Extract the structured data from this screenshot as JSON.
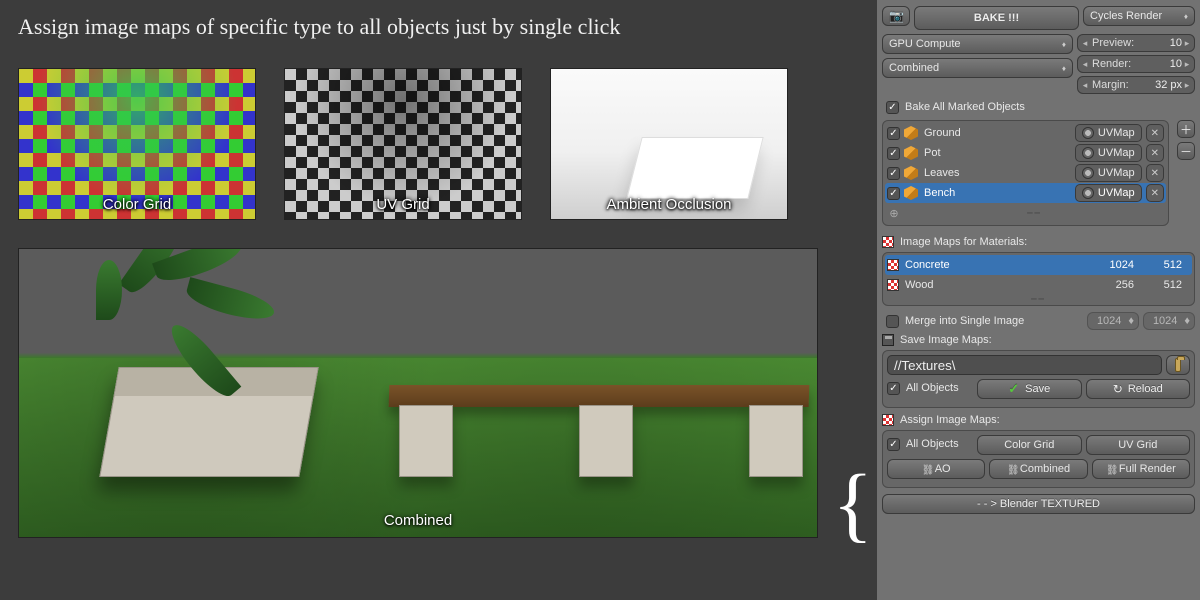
{
  "headline": "Assign image maps of specific type to all objects just by single click",
  "thumbs": [
    {
      "label": "Color Grid"
    },
    {
      "label": "UV Grid"
    },
    {
      "label": "Ambient Occlusion"
    }
  ],
  "big_label": "Combined",
  "panel": {
    "bake_button": "BAKE !!!",
    "render_engine": "Cycles Render",
    "device": "GPU Compute",
    "bake_pass": "Combined",
    "preview": {
      "label": "Preview:",
      "value": "10"
    },
    "render": {
      "label": "Render:",
      "value": "10"
    },
    "margin": {
      "label": "Margin:",
      "value": "32 px"
    },
    "bake_all_label": "Bake All Marked Objects",
    "objects": [
      {
        "name": "Ground",
        "uv": "UVMap",
        "selected": false
      },
      {
        "name": "Pot",
        "uv": "UVMap",
        "selected": false
      },
      {
        "name": "Leaves",
        "uv": "UVMap",
        "selected": false
      },
      {
        "name": "Bench",
        "uv": "UVMap",
        "selected": true
      }
    ],
    "materials_header": "Image Maps for Materials:",
    "materials": [
      {
        "name": "Concrete",
        "w": "1024",
        "h": "512",
        "selected": true
      },
      {
        "name": "Wood",
        "w": "256",
        "h": "512",
        "selected": false
      }
    ],
    "merge_label": "Merge into Single Image",
    "merge_w": "1024",
    "merge_h": "1024",
    "save_header": "Save Image Maps:",
    "save_path": "//Textures\\",
    "all_objects_label": "All Objects",
    "save_button": "Save",
    "reload_button": "Reload",
    "assign_header": "Assign Image Maps:",
    "assign_buttons": {
      "color_grid": "Color Grid",
      "uv_grid": "UV Grid",
      "ao": "AO",
      "combined": "Combined",
      "full_render": "Full Render"
    },
    "footer_button": "- - > Blender TEXTURED"
  }
}
